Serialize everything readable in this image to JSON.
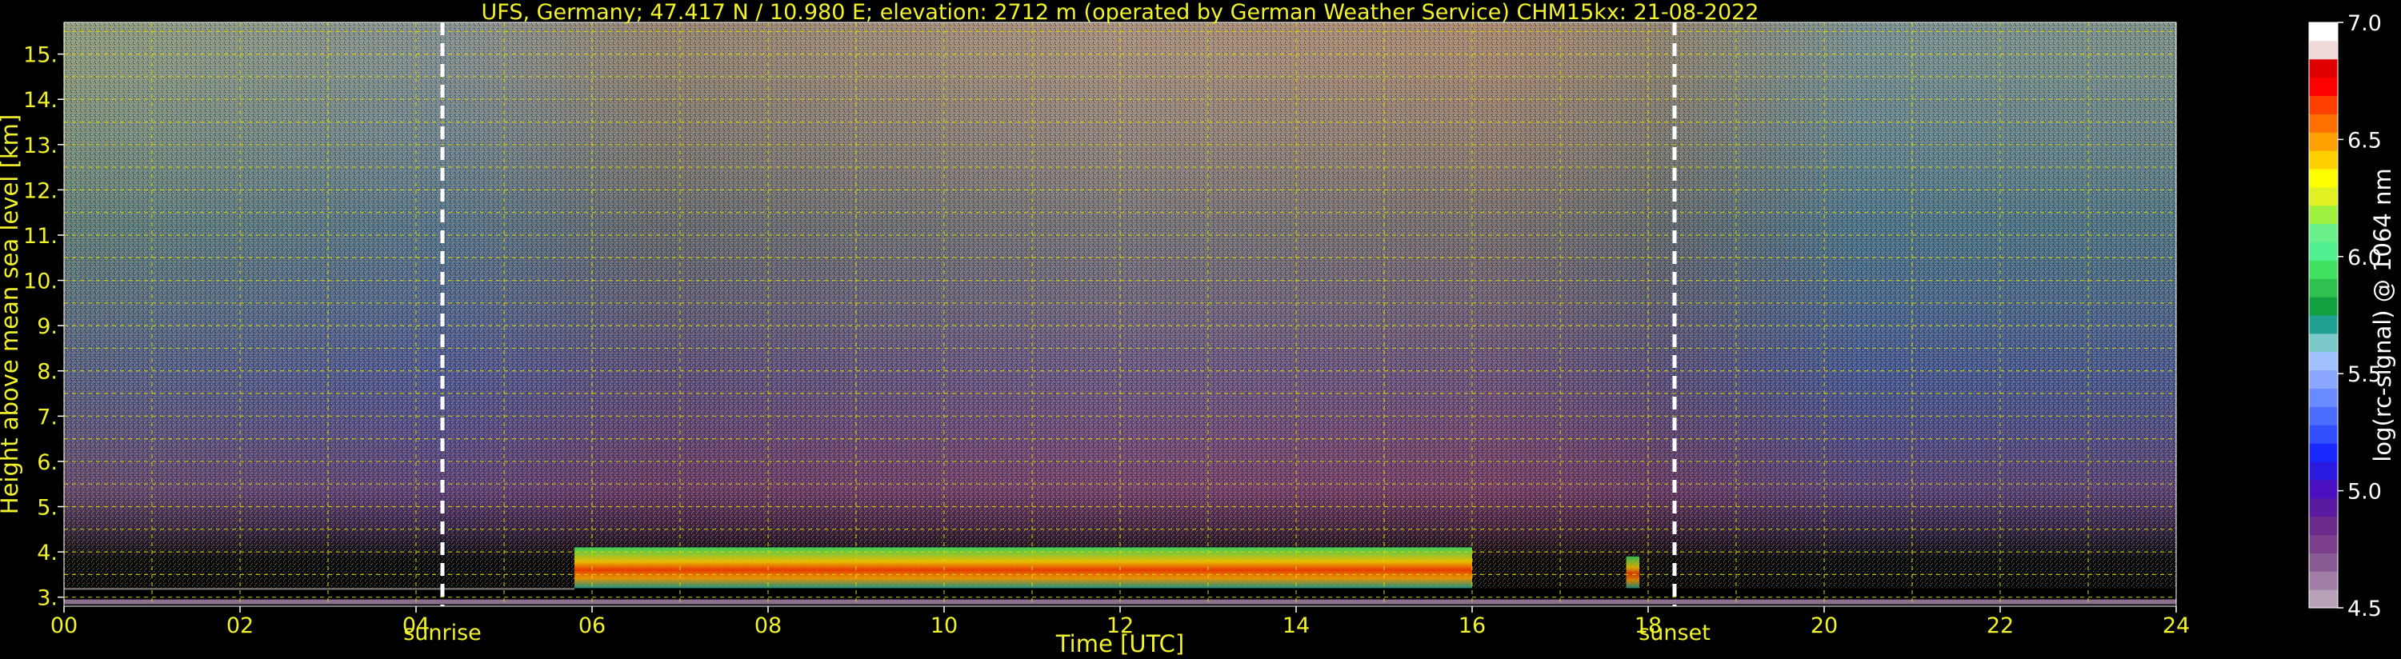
{
  "chart_data": {
    "type": "heatmap",
    "title": "UFS, Germany; 47.417 N / 10.980 E; elevation: 2712 m  (operated by German Weather Service)    CHM15kx: 21-08-2022",
    "xlabel": "Time [UTC]",
    "ylabel": "Height above mean sea level [km]",
    "xlim": [
      0,
      24
    ],
    "ylim": [
      2.8,
      15.7
    ],
    "x_ticks": [
      "00",
      "02",
      "04",
      "06",
      "08",
      "10",
      "12",
      "14",
      "16",
      "18",
      "20",
      "22",
      "24"
    ],
    "y_ticks": [
      "3.",
      "4.",
      "5.",
      "6.",
      "7.",
      "8.",
      "9.",
      "10.",
      "11.",
      "12.",
      "13.",
      "14.",
      "15."
    ],
    "grid": true,
    "markers": [
      {
        "label": "sunrise",
        "x": 4.3
      },
      {
        "label": "sunset",
        "x": 18.3
      }
    ],
    "colorbar": {
      "label": "log(rc-signal) @ 1064 nm",
      "range": [
        4.5,
        7.0
      ],
      "ticks": [
        "4.5",
        "5.0",
        "5.5",
        "6.0",
        "6.5",
        "7.0"
      ],
      "colors": [
        "#b8a2b8",
        "#a07ea6",
        "#8a5c96",
        "#7a3e8a",
        "#6a2a8a",
        "#5a1aa0",
        "#4a10c0",
        "#2a1ae0",
        "#1a2aff",
        "#3050ff",
        "#4a6cff",
        "#6a8aff",
        "#8aa6ff",
        "#a0c0ff",
        "#7ac8c8",
        "#20a090",
        "#10a040",
        "#30c050",
        "#40e060",
        "#50f090",
        "#6af08a",
        "#a0f040",
        "#e0f020",
        "#ffff00",
        "#ffd000",
        "#ffa000",
        "#ff7000",
        "#ff4000",
        "#ff0000",
        "#e00000",
        "#f0d8d8",
        "#ffffff"
      ]
    },
    "cloud_layer": {
      "base": 3.2,
      "top": 4.1,
      "start": 5.8,
      "end": 16.0
    }
  }
}
